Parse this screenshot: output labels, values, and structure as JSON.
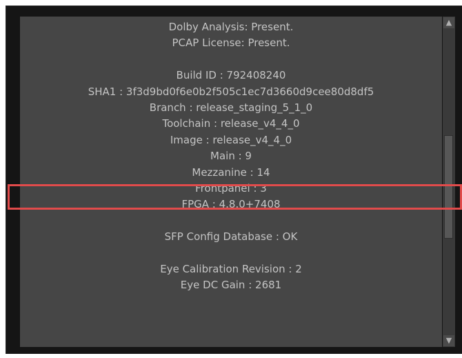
{
  "info_lines": [
    "Dolby Analysis: Present.",
    "PCAP License: Present.",
    "",
    "Build ID : 792408240",
    "SHA1 : 3f3d9bd0f6e0b2f505c1ec7d3660d9cee80d8df5",
    "Branch : release_staging_5_1_0",
    "Toolchain : release_v4_4_0",
    "Image : release_v4_4_0",
    "Main : 9",
    "Mezzanine : 14",
    "Frontpanel : 3",
    "FPGA : 4.8.0+7408",
    "",
    "SFP Config Database : OK",
    "",
    "Eye Calibration Revision : 2",
    "Eye DC Gain : 2681"
  ],
  "scrollbar": {
    "up_icon": "triangle-up",
    "down_icon": "triangle-down"
  },
  "highlight": {
    "color": "#e24b4b",
    "target_line": "Mezzanine : 14"
  }
}
